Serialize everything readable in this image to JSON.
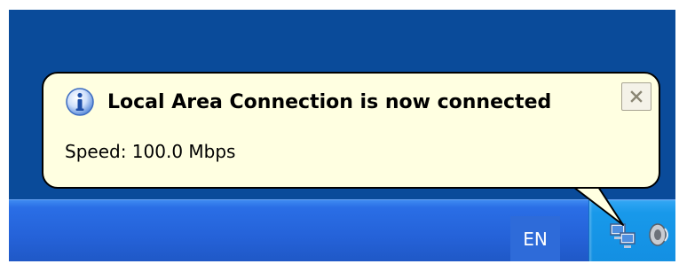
{
  "notification": {
    "title": "Local Area Connection is now connected",
    "body": "Speed: 100.0 Mbps",
    "icon": "info-icon",
    "close_icon": "close-icon"
  },
  "taskbar": {
    "language": "EN",
    "tray_icons": [
      "network-connected-icon",
      "volume-icon"
    ]
  },
  "colors": {
    "desktop": "#0a4b9a",
    "balloon_bg": "#ffffe1",
    "taskbar": "#2562d8",
    "tray": "#138fe2"
  }
}
